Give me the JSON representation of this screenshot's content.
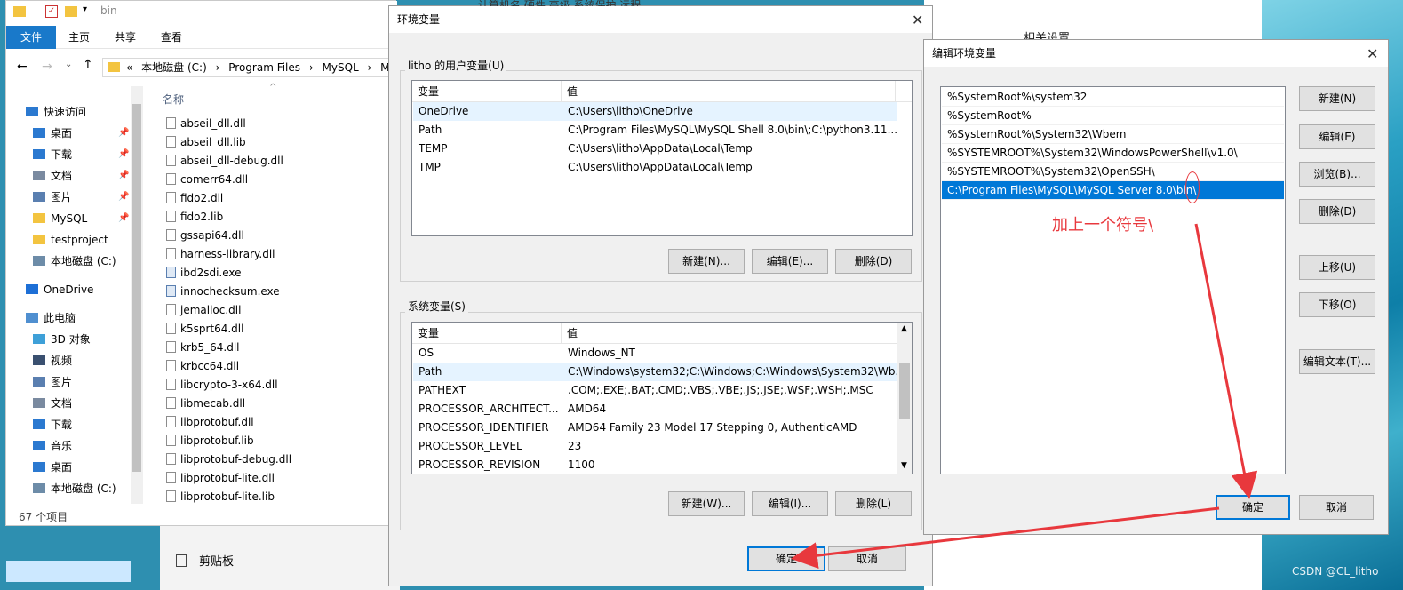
{
  "explorer": {
    "title": "bin",
    "ribbon_tabs": [
      "文件",
      "主页",
      "共享",
      "查看"
    ],
    "address": [
      "«",
      "本地磁盘 (C:)",
      "›",
      "Program Files",
      "›",
      "MySQL",
      "›",
      "My"
    ],
    "column_name": "名称",
    "nav": [
      {
        "label": "快速访问",
        "icon": "star-icon",
        "pinned": false
      },
      {
        "label": "桌面",
        "icon": "desktop-icon",
        "pinned": true
      },
      {
        "label": "下载",
        "icon": "download-icon",
        "pinned": true
      },
      {
        "label": "文档",
        "icon": "document-icon",
        "pinned": true
      },
      {
        "label": "图片",
        "icon": "picture-icon",
        "pinned": true
      },
      {
        "label": "MySQL",
        "icon": "folder-icon",
        "pinned": true
      },
      {
        "label": "testproject",
        "icon": "folder-icon",
        "pinned": false
      },
      {
        "label": "本地磁盘 (C:)",
        "icon": "drive-icon",
        "pinned": false
      },
      {
        "label": "OneDrive",
        "icon": "cloud-icon",
        "pinned": false
      },
      {
        "label": "此电脑",
        "icon": "computer-icon",
        "pinned": false
      },
      {
        "label": "3D 对象",
        "icon": "cube-icon",
        "pinned": false
      },
      {
        "label": "视频",
        "icon": "video-icon",
        "pinned": false
      },
      {
        "label": "图片",
        "icon": "picture-icon",
        "pinned": false
      },
      {
        "label": "文档",
        "icon": "document-icon",
        "pinned": false
      },
      {
        "label": "下载",
        "icon": "download-icon",
        "pinned": false
      },
      {
        "label": "音乐",
        "icon": "music-icon",
        "pinned": false
      },
      {
        "label": "桌面",
        "icon": "desktop-icon",
        "pinned": false
      },
      {
        "label": "本地磁盘 (C:)",
        "icon": "drive-icon",
        "pinned": false
      }
    ],
    "files": [
      "abseil_dll.dll",
      "abseil_dll.lib",
      "abseil_dll-debug.dll",
      "comerr64.dll",
      "fido2.dll",
      "fido2.lib",
      "gssapi64.dll",
      "harness-library.dll",
      "ibd2sdi.exe",
      "innochecksum.exe",
      "jemalloc.dll",
      "k5sprt64.dll",
      "krb5_64.dll",
      "krbcc64.dll",
      "libcrypto-3-x64.dll",
      "libmecab.dll",
      "libprotobuf.dll",
      "libprotobuf.lib",
      "libprotobuf-debug.dll",
      "libprotobuf-lite.dll",
      "libprotobuf-lite.lib"
    ],
    "status": "67 个项目",
    "clipboard": "剪贴板"
  },
  "env_dialog": {
    "title": "环境变量",
    "user_group": "litho 的用户变量(U)",
    "col_var": "变量",
    "col_val": "值",
    "user_vars": [
      {
        "name": "OneDrive",
        "value": "C:\\Users\\litho\\OneDrive"
      },
      {
        "name": "Path",
        "value": "C:\\Program Files\\MySQL\\MySQL Shell 8.0\\bin\\;C:\\python3.11...."
      },
      {
        "name": "TEMP",
        "value": "C:\\Users\\litho\\AppData\\Local\\Temp"
      },
      {
        "name": "TMP",
        "value": "C:\\Users\\litho\\AppData\\Local\\Temp"
      }
    ],
    "user_buttons": [
      "新建(N)...",
      "编辑(E)...",
      "删除(D)"
    ],
    "sys_group": "系统变量(S)",
    "sys_vars": [
      {
        "name": "OS",
        "value": "Windows_NT"
      },
      {
        "name": "Path",
        "value": "C:\\Windows\\system32;C:\\Windows;C:\\Windows\\System32\\Wb..."
      },
      {
        "name": "PATHEXT",
        "value": ".COM;.EXE;.BAT;.CMD;.VBS;.VBE;.JS;.JSE;.WSF;.WSH;.MSC"
      },
      {
        "name": "PROCESSOR_ARCHITECT...",
        "value": "AMD64"
      },
      {
        "name": "PROCESSOR_IDENTIFIER",
        "value": "AMD64 Family 23 Model 17 Stepping 0, AuthenticAMD"
      },
      {
        "name": "PROCESSOR_LEVEL",
        "value": "23"
      },
      {
        "name": "PROCESSOR_REVISION",
        "value": "1100"
      }
    ],
    "sys_buttons": [
      "新建(W)...",
      "编辑(I)...",
      "删除(L)"
    ],
    "ok": "确定",
    "cancel": "取消",
    "behind_tabs": "计算机名  硬件  高级  系统保护  远程"
  },
  "edit_dialog": {
    "title": "编辑环境变量",
    "paths": [
      "%SystemRoot%\\system32",
      "%SystemRoot%",
      "%SystemRoot%\\System32\\Wbem",
      "%SYSTEMROOT%\\System32\\WindowsPowerShell\\v1.0\\",
      "%SYSTEMROOT%\\System32\\OpenSSH\\",
      "C:\\Program Files\\MySQL\\MySQL Server 8.0\\bin\\"
    ],
    "buttons": [
      "新建(N)",
      "编辑(E)",
      "浏览(B)...",
      "删除(D)",
      "上移(U)",
      "下移(O)",
      "编辑文本(T)..."
    ],
    "ok": "确定",
    "cancel": "取消"
  },
  "annotation": "加上一个符号\\",
  "background": {
    "related_settings": "相关设置"
  },
  "watermark": "CSDN @CL_litho",
  "colors": {
    "accent": "#0078d7",
    "annotation": "#e8383d"
  }
}
